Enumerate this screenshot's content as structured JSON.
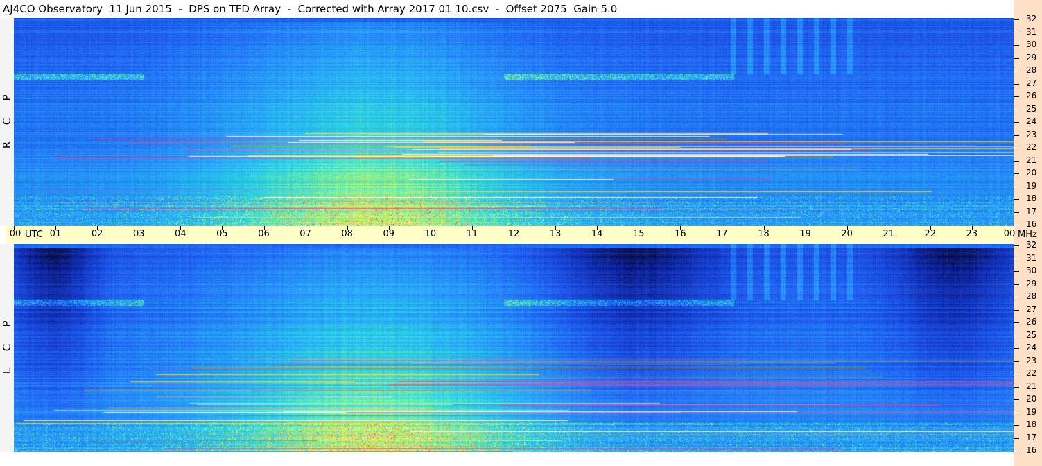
{
  "title": "AJ4CO Observatory  11 Jun 2015  -  DPS on TFD Array  -  Corrected with Array 2017 01 10.csv  -  Offset 2075  Gain 5.0",
  "chart_data": {
    "type": "heatmap",
    "panels": [
      {
        "name": "RCP",
        "letters": [
          "R",
          "C",
          "P"
        ]
      },
      {
        "name": "LCP",
        "letters": [
          "L",
          "C",
          "P"
        ]
      }
    ],
    "x_axis": {
      "unit_label": "UTC",
      "ticks": [
        "00",
        "01",
        "02",
        "03",
        "04",
        "05",
        "06",
        "07",
        "08",
        "09",
        "10",
        "11",
        "12",
        "13",
        "14",
        "15",
        "16",
        "17",
        "18",
        "19",
        "20",
        "21",
        "22",
        "23",
        "00"
      ]
    },
    "y_axis": {
      "unit_label": "MHz",
      "ticks": [
        "32",
        "31",
        "30",
        "29",
        "28",
        "27",
        "26",
        "25",
        "24",
        "23",
        "22",
        "21",
        "20",
        "19",
        "18",
        "17",
        "16"
      ],
      "range": [
        16,
        32
      ]
    },
    "colormap": "jet-like (dark blue → cyan → yellow → red/magenta → white)",
    "colors": {
      "axis_bg": "#ffffc8",
      "right_strip": "#fde0c6",
      "low": "#0a1a6e",
      "mid": "#1e90ff",
      "high": "#ffff40"
    }
  }
}
